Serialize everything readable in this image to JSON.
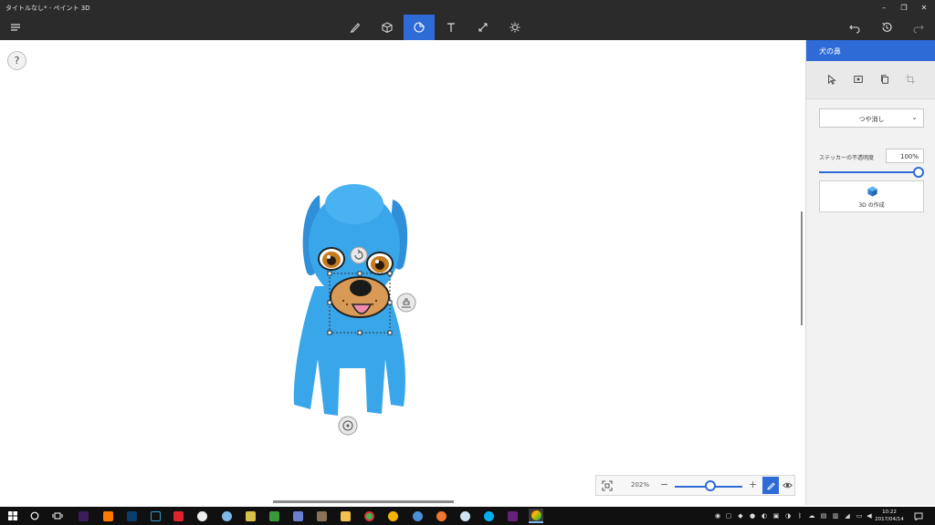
{
  "window": {
    "title": "タイトルなし* - ペイント 3D",
    "minimize_glyph": "–",
    "restore_glyph": "❐",
    "close_glyph": "✕"
  },
  "toolbar": {
    "tools": [
      "brush-icon",
      "cube-icon",
      "sticker-icon",
      "text-icon",
      "canvas-icon",
      "effects-icon"
    ],
    "active_tool": "sticker-icon",
    "menu_icon": "hamburger-menu-icon",
    "right_icons": [
      "undo-icon",
      "history-icon",
      "redo-icon"
    ]
  },
  "canvas": {
    "help_label": "?",
    "zoom": {
      "percent_label": "202%",
      "minus": "−",
      "plus": "+",
      "level": 0.45
    }
  },
  "panel": {
    "title": "犬の鼻",
    "tools": [
      "select-icon",
      "stamp-icon",
      "copy-icon",
      "crop-icon"
    ],
    "finish": {
      "selected": "つや消し",
      "chevron": "⌄"
    },
    "opacity": {
      "label": "ステッカーの不透明度",
      "value": "100%",
      "level": 1.0
    },
    "make3d_label": "3D の作成"
  },
  "taskbar": {
    "clock_time": "10:22",
    "clock_date": "2017/04/14",
    "accent": "#2f6bd6",
    "model_color": "#3aa6ea"
  }
}
